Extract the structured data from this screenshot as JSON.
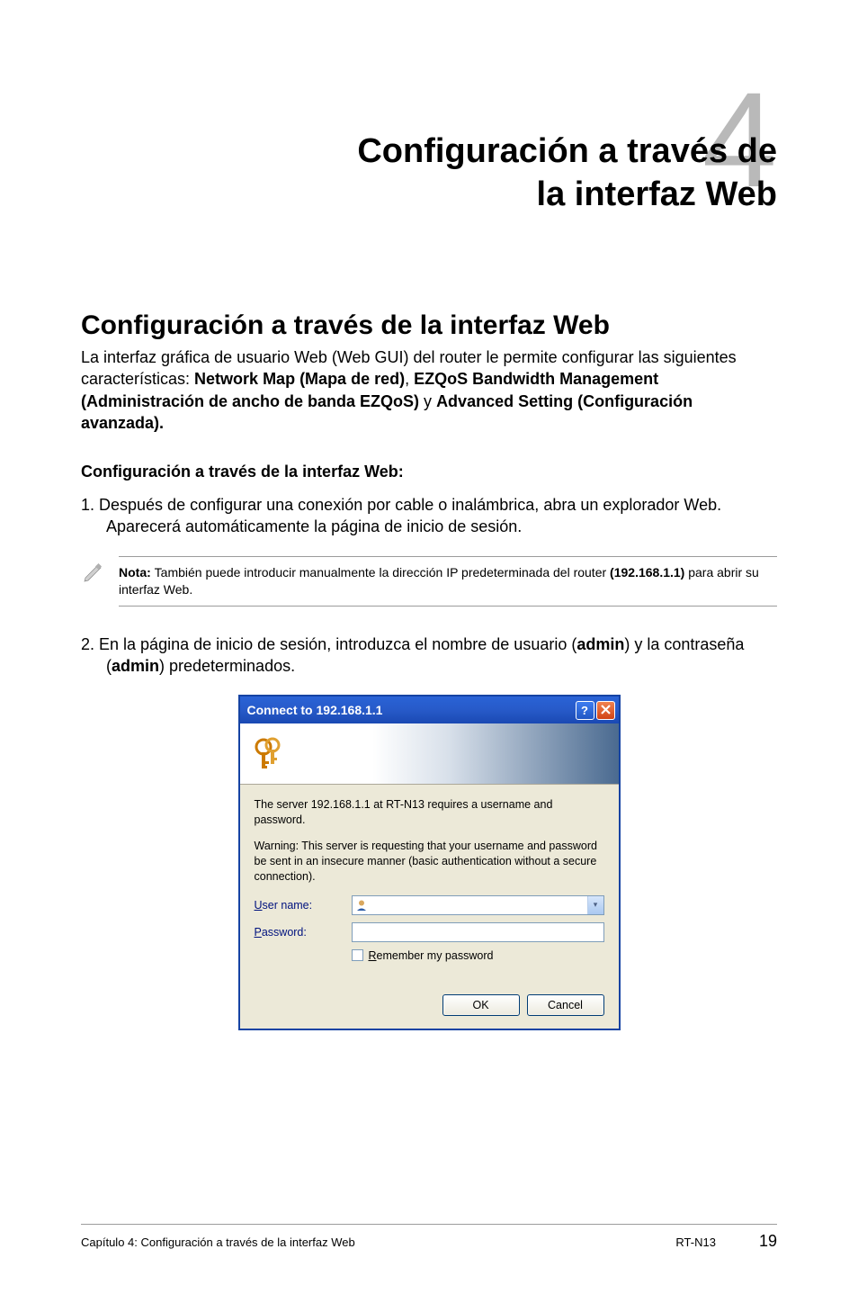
{
  "chapter": {
    "number": "4",
    "title_line1": "Configuración a través de",
    "title_line2": "la interfaz Web"
  },
  "section": {
    "heading": "Configuración a través de la interfaz Web",
    "intro_pre": "La interfaz gráfica de usuario Web (Web GUI) del router le permite configurar las siguientes características: ",
    "intro_b1": "Network Map (Mapa de red)",
    "intro_sep1": ", ",
    "intro_b2": "EZQoS Bandwidth Management (Administración de ancho de banda EZQoS)",
    "intro_sep2": " y ",
    "intro_b3": "Advanced Setting (Configuración avanzada).",
    "sub_heading": "Configuración a través de la interfaz Web:",
    "step1_num": "1.  ",
    "step1_text": "Después de configurar una conexión por cable o inalámbrica, abra un explorador Web. Aparecerá automáticamente la página de inicio de sesión.",
    "note_label": "Nota: ",
    "note_text_a": "También puede introducir manualmente la dirección IP predeterminada del router ",
    "note_ip": "(192.168.1.1)",
    "note_text_b": " para abrir su interfaz Web.",
    "step2_num": "2.  ",
    "step2_pre": "En la página de inicio de sesión, introduzca el nombre de usuario (",
    "step2_b1": "admin",
    "step2_mid": ") y la contraseña (",
    "step2_b2": "admin",
    "step2_post": ") predeterminados."
  },
  "dialog": {
    "title": "Connect to 192.168.1.1",
    "help": "?",
    "close": "X",
    "msg1": "The server 192.168.1.1 at RT-N13 requires a username and password.",
    "msg2": "Warning: This server is requesting that your username and password be sent in an insecure manner (basic authentication without a secure connection).",
    "user_label_u": "U",
    "user_label_rest": "ser name:",
    "pass_label_u": "P",
    "pass_label_rest": "assword:",
    "remember_u": "R",
    "remember_rest": "emember my password",
    "ok": "OK",
    "cancel": "Cancel"
  },
  "footer": {
    "left": "Capítulo 4: Configuración a través de la interfaz Web",
    "model": "RT-N13",
    "page": "19"
  }
}
